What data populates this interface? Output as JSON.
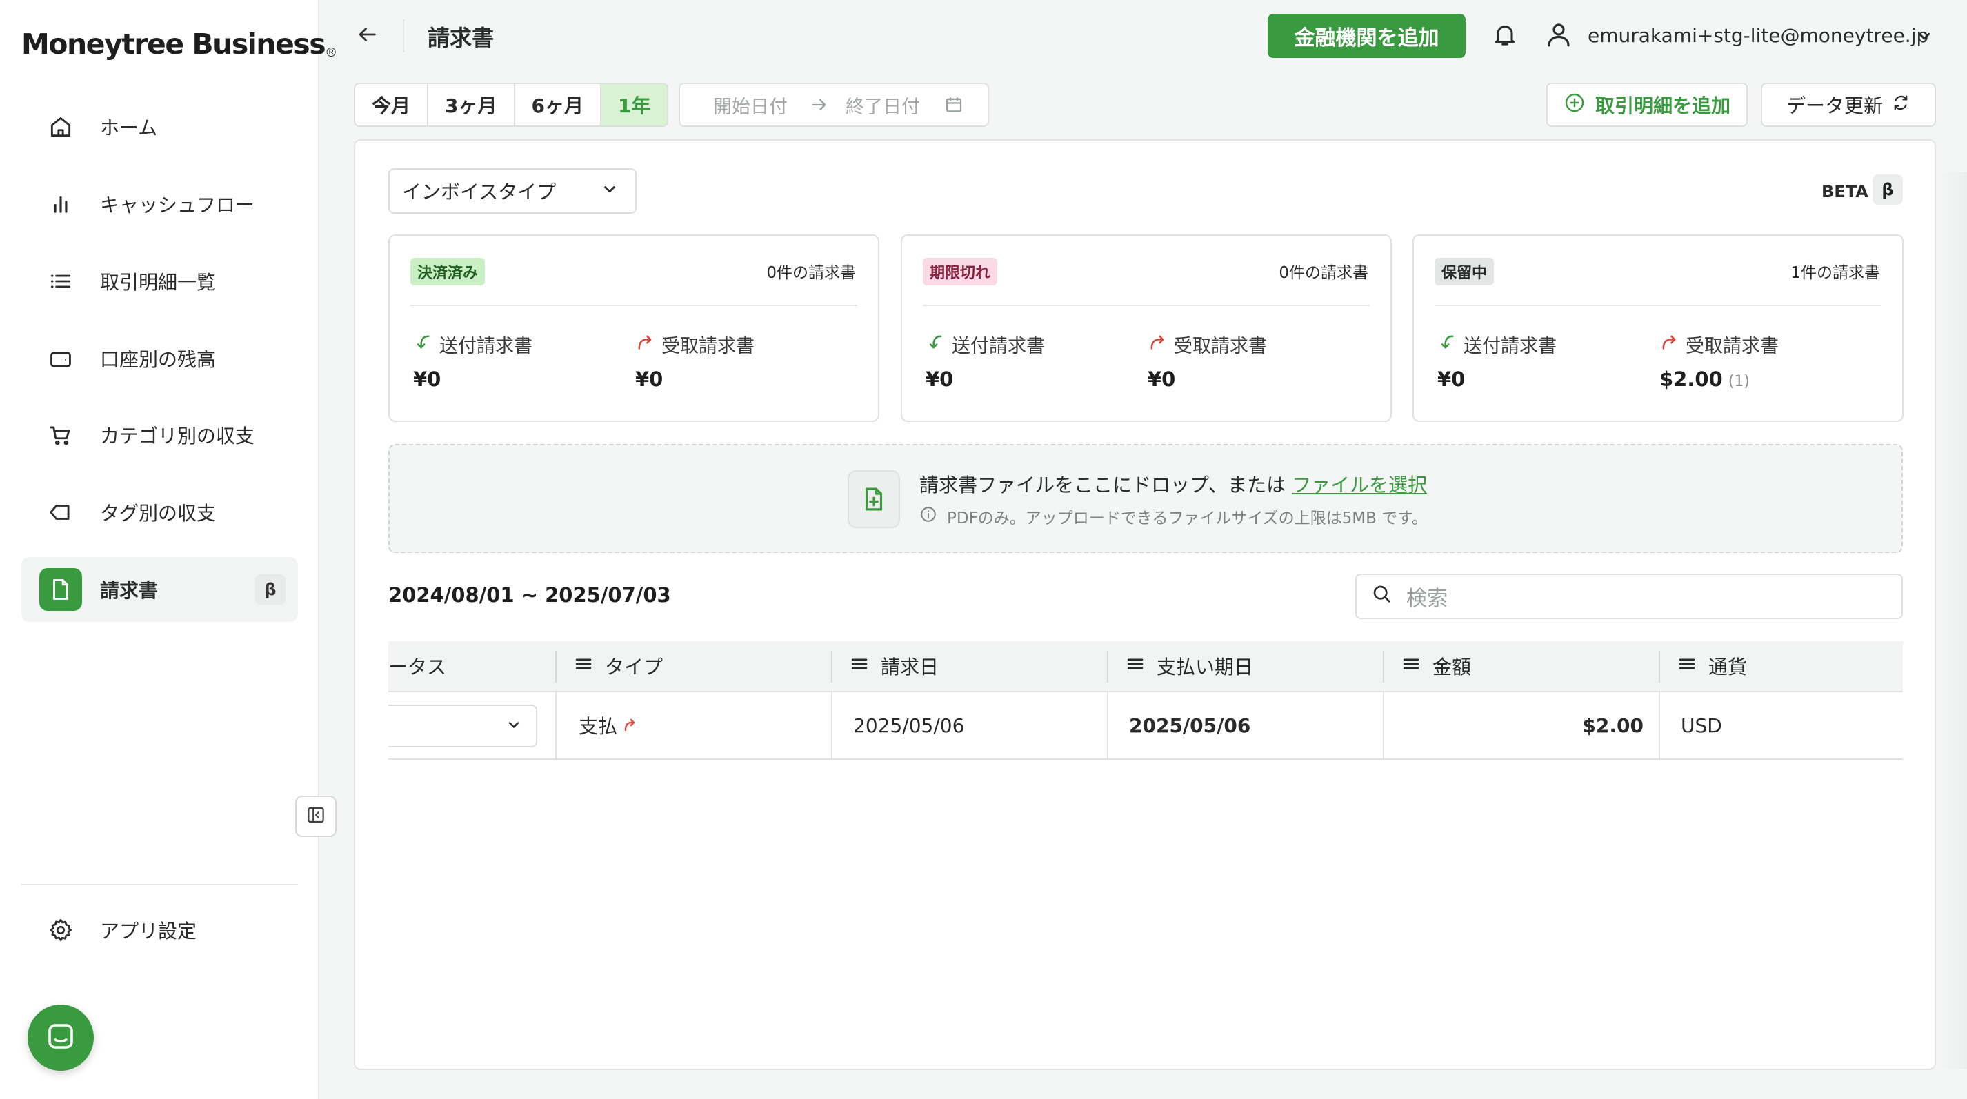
{
  "brand": {
    "name": "Moneytree Business",
    "mark": "®"
  },
  "sidebar": {
    "items": [
      {
        "label": "ホーム",
        "icon": "home-icon"
      },
      {
        "label": "キャッシュフロー",
        "icon": "bar-chart-icon"
      },
      {
        "label": "取引明細一覧",
        "icon": "list-icon"
      },
      {
        "label": "口座別の残高",
        "icon": "wallet-icon"
      },
      {
        "label": "カテゴリ別の収支",
        "icon": "cart-icon"
      },
      {
        "label": "タグ別の収支",
        "icon": "tag-icon"
      },
      {
        "label": "請求書",
        "icon": "document-icon",
        "active": true,
        "badge": "β"
      }
    ],
    "settings_label": "アプリ設定"
  },
  "header": {
    "title": "請求書",
    "add_bank_label": "金融機関を追加",
    "user_email": "emurakami+stg-lite@moneytree.jp"
  },
  "period": {
    "options": [
      "今月",
      "3ヶ月",
      "6ヶ月",
      "1年"
    ],
    "selected": "1年",
    "start_placeholder": "開始日付",
    "end_placeholder": "終了日付"
  },
  "actions": {
    "add_transaction_label": "取引明細を追加",
    "refresh_label": "データ更新"
  },
  "filter": {
    "invoice_type_label": "インボイスタイプ"
  },
  "beta": {
    "label": "BETA",
    "badge": "β"
  },
  "summary": [
    {
      "status": "決済済み",
      "count": "0件の請求書",
      "sent_label": "送付請求書",
      "sent_amount": "¥0",
      "received_label": "受取請求書",
      "received_amount": "¥0",
      "received_extra": ""
    },
    {
      "status": "期限切れ",
      "count": "0件の請求書",
      "sent_label": "送付請求書",
      "sent_amount": "¥0",
      "received_label": "受取請求書",
      "received_amount": "¥0",
      "received_extra": ""
    },
    {
      "status": "保留中",
      "count": "1件の請求書",
      "sent_label": "送付請求書",
      "sent_amount": "¥0",
      "received_label": "受取請求書",
      "received_amount": "$2.00",
      "received_extra": "(1)"
    }
  ],
  "upload": {
    "text": "請求書ファイルをここにドロップ、または",
    "link": "ファイルを選択",
    "note": "PDFのみ。アップロードできるファイルサイズの上限は5MB です。"
  },
  "range_title": "2024/08/01 ~ 2025/07/03",
  "search": {
    "placeholder": "検索"
  },
  "table": {
    "headers": [
      "ータス",
      "タイプ",
      "請求日",
      "支払い期日",
      "金額",
      "通貨"
    ],
    "rows": [
      {
        "status": "",
        "type": "支払",
        "invoice_date": "2025/05/06",
        "due_date": "2025/05/06",
        "amount": "$2.00",
        "currency": "USD"
      }
    ]
  },
  "colors": {
    "accent": "#3a9a3f",
    "settled_bg": "#c9efc3",
    "overdue_bg": "#f9d9e4",
    "pending_bg": "#e4e6e5",
    "sent_arrow": "#3a9a3f",
    "received_arrow": "#d64a3a"
  }
}
